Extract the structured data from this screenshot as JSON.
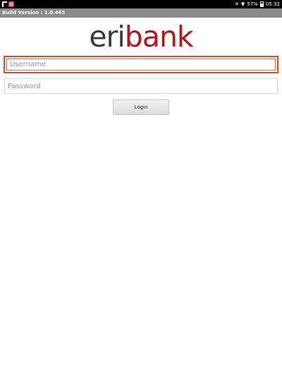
{
  "status_bar": {
    "battery_percent": "57%",
    "time": "05:32",
    "icons": [
      "f-notification-icon",
      "app-notification-icon",
      "mute-icon",
      "wifi-icon",
      "battery-icon"
    ]
  },
  "title_bar": {
    "text": "Build Version : 1.0.465"
  },
  "logo": {
    "part1": "eri",
    "part2": "bank",
    "color_part1": "#3a3a3a",
    "color_part2": "#b8141e"
  },
  "form": {
    "username_placeholder": "Username",
    "username_value": "",
    "password_placeholder": "Password",
    "password_value": "",
    "login_label": "Login"
  },
  "colors": {
    "focus_border": "#e24a1c",
    "title_bar_bg": "#8a8a8a"
  }
}
